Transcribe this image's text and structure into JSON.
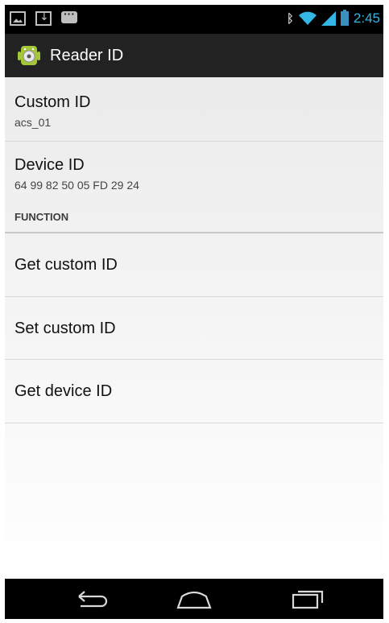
{
  "status_bar": {
    "left_icons": [
      "gallery-icon",
      "download-icon",
      "chat-icon"
    ],
    "right_icons": [
      "bluetooth-icon",
      "wifi-icon",
      "signal-icon",
      "battery-icon"
    ],
    "time": "2:45",
    "time_color": "#33b5e5"
  },
  "action_bar": {
    "icon": "android-icon",
    "title": "Reader ID"
  },
  "preferences": {
    "custom_id": {
      "title": "Custom ID",
      "summary": "acs_01"
    },
    "device_id": {
      "title": "Device ID",
      "summary": "64 99 82 50 05 FD 29 24"
    },
    "category": "FUNCTION",
    "actions": [
      {
        "label": "Get custom ID"
      },
      {
        "label": "Set custom ID"
      },
      {
        "label": "Get device ID"
      }
    ]
  },
  "nav_bar": {
    "buttons": [
      "back-icon",
      "home-icon",
      "recent-apps-icon"
    ]
  }
}
